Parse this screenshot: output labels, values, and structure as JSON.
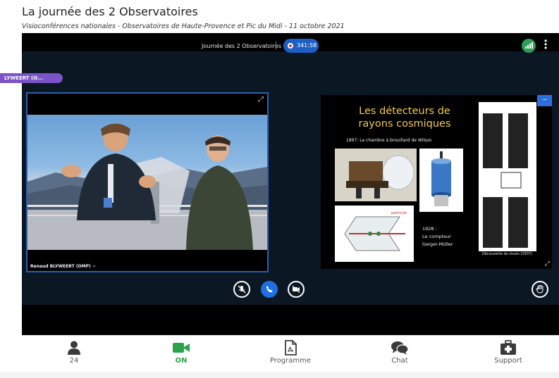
{
  "page": {
    "title": "La journée des 2 Observatoires",
    "subtitle": "Visioconférences nationales - Observatoires de Haute-Provence et Pic du Midi - 11 octobre 2021"
  },
  "meeting": {
    "title": "Journée des 2 Observatoires",
    "timer": "341:58",
    "presenter_pill": "LYWEERT (O...",
    "icons": [
      "signal-icon",
      "more-vertical-icon",
      "expand-icon"
    ]
  },
  "video": {
    "caption": "Renaud BLYWEERT (OMP) ~"
  },
  "slide": {
    "title_line1": "Les détecteurs de",
    "title_line2": "rayons cosmiques",
    "line_1897": "1897: La chambre à brouillard de Wilson",
    "line_1928": "1928 :",
    "line_counter1": "Le compteur",
    "line_counter2": "Geiger-Müller",
    "caption": "Découverte du muon (1937)",
    "minimize_label": "–"
  },
  "controls": {
    "mute_icon": "mic-off-icon",
    "hangup_icon": "phone-icon",
    "camera_icon": "video-off-icon",
    "hand_icon": "raise-hand-icon"
  },
  "footer": {
    "items": [
      {
        "label": "24",
        "icon": "user-icon"
      },
      {
        "label": "ON",
        "icon": "camera-icon"
      },
      {
        "label": "Programme",
        "icon": "pdf-file-icon"
      },
      {
        "label": "Chat",
        "icon": "chat-bubbles-icon"
      },
      {
        "label": "Support",
        "icon": "medical-kit-icon"
      }
    ]
  },
  "colors": {
    "accent_blue": "#1e6fe0",
    "on_green": "#2aa34a",
    "pill_purple": "#7a54c8",
    "slide_title_yellow": "#f2c94c"
  }
}
